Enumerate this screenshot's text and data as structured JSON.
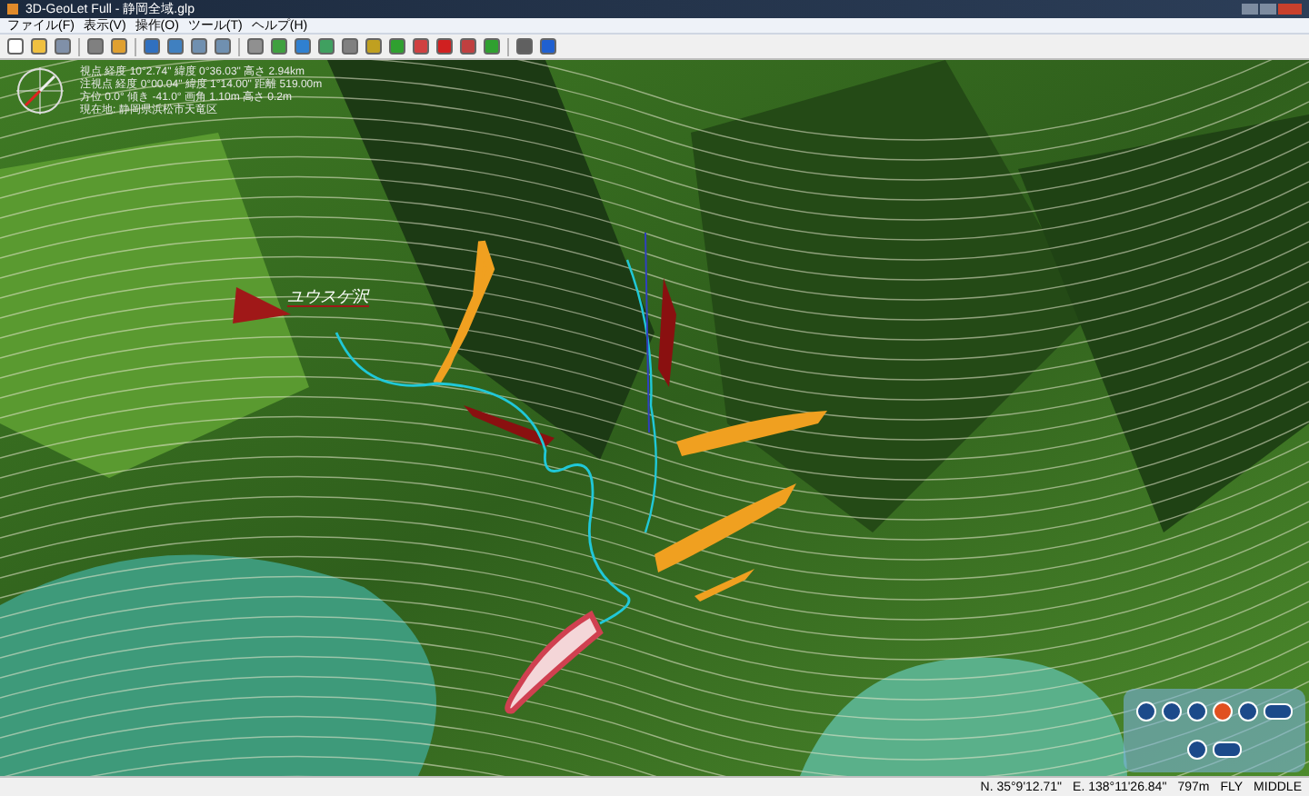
{
  "window": {
    "title": "3D-GeoLet Full - 静岡全域.glp"
  },
  "menu": [
    "ファイル(F)",
    "表示(V)",
    "操作(O)",
    "ツール(T)",
    "ヘルプ(H)"
  ],
  "info_overlay": [
    "視点  経度 10°2.74\"  緯度 0°36.03\"  高さ 2.94km",
    "注視点 経度 0°00.04\"  緯度 1°14.00\"  距離 519.00m",
    "方位 0.0°  傾き -41.0°  画角 1.10m  高さ 0.2m",
    "現在地: 静岡県浜松市天竜区"
  ],
  "map_label": "ユウスゲ沢",
  "status_bar": [
    "N. 35°9'12.71\"",
    "E. 138°11'26.84\"",
    "797m",
    "FLY",
    "MIDDLE"
  ]
}
